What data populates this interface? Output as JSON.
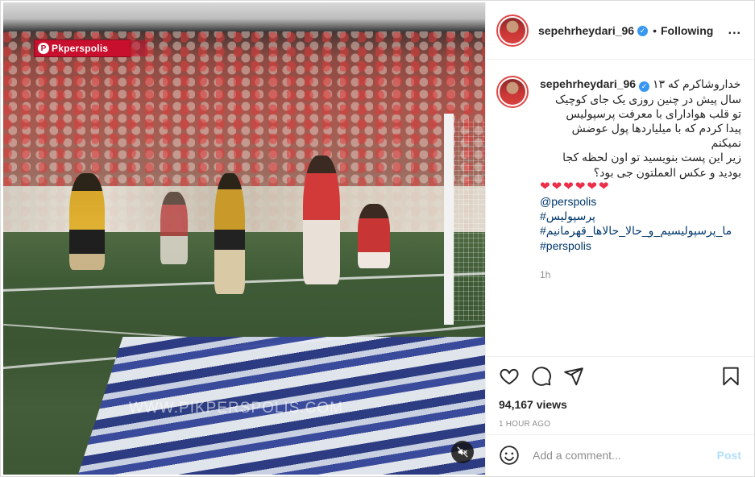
{
  "video": {
    "logo_text": "Pkperspolis",
    "watermark": "WWW.PIKPERSPOLIS.COM",
    "mute_icon": "speaker-muted-icon"
  },
  "header": {
    "username": "sepehrheydari_96",
    "separator": "•",
    "follow_state": "Following",
    "more_icon": "ellipsis",
    "more_label": "..."
  },
  "caption": {
    "username": "sepehrheydari_96",
    "lines": [
      "خداروشاکرم که ۱۳",
      "سال پیش در چنین روزی یک جای کوچیک",
      "تو قلب هوادارای با معرفت پرسپولیس",
      "پیدا کردم که با میلیاردها پول عوضش",
      "نمیکنم",
      "زیر این پست بنویسید تو اون لحظه کجا",
      "بودید و عکس العملتون جی بود؟"
    ],
    "hearts": "❤❤❤❤❤❤",
    "tags": [
      "@perspolis",
      "#پرسپولیس",
      "#ما_پرسپولیسیم_و_حالا_حالاها_قهرمانیم",
      "#perspolis"
    ],
    "age": "1h"
  },
  "actions": {
    "like_icon": "heart-outline",
    "comment_icon": "speech-bubble",
    "share_icon": "paper-plane",
    "save_icon": "bookmark",
    "views": "94,167 views",
    "posted_ago": "1 HOUR AGO"
  },
  "comment_box": {
    "emoji_icon": "smiley-face",
    "placeholder": "Add a comment...",
    "post_label": "Post"
  },
  "colors": {
    "verified_blue": "#3897f0",
    "link_blue": "#00376b",
    "heart_red": "#ed2e48",
    "post_disabled": "#b2dffc",
    "muted_text": "#8e8e8e",
    "story_ring": "#e04848"
  }
}
